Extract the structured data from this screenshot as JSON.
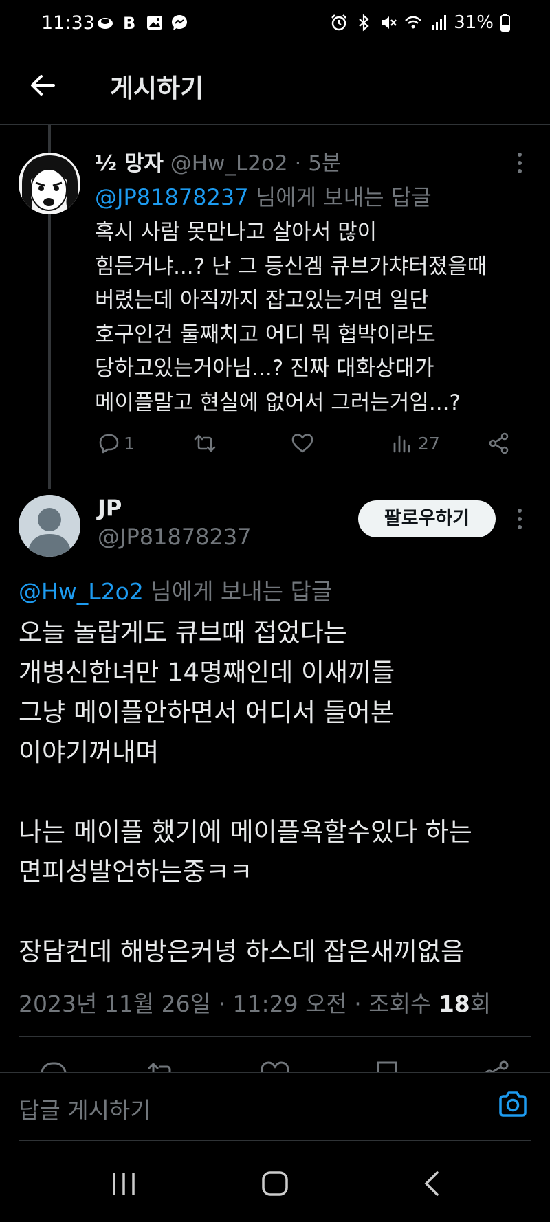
{
  "status_bar": {
    "time": "11:33",
    "left_icons": [
      "threads-icon",
      "b-icon",
      "gallery-icon",
      "messenger-icon"
    ],
    "right_icons": [
      "alarm-icon",
      "bluetooth-icon",
      "mute-icon",
      "wifi-icon",
      "signal-icon"
    ],
    "battery_percent": "31%"
  },
  "header": {
    "title": "게시하기"
  },
  "parent_tweet": {
    "display_name": "½ 망자",
    "handle": "@Hw_L2o2",
    "time": "· 5분",
    "reply_to_mention": "@JP81878237",
    "reply_to_suffix": " 님에게 보내는 답글",
    "text_lines": [
      "혹시 사람 못만나고 살아서 많이",
      "힘든거냐...? 난 그 등신겜 큐브가챠터졌을때",
      "버렸는데 아직까지 잡고있는거면 일단",
      "호구인건 둘째치고 어디 뭐 협박이라도",
      "당하고있는거아님...? 진짜 대화상대가",
      "메이플말고 현실에 없어서 그러는거임...?"
    ],
    "replies": "1",
    "views": "27"
  },
  "main_tweet": {
    "display_name": "JP",
    "handle": "@JP81878237",
    "follow_label": "팔로우하기",
    "reply_to_mention": "@Hw_L2o2",
    "reply_to_suffix": " 님에게 보내는 답글",
    "text": "오늘 놀랍게도 큐브때 접었다는\n개병신한녀만 14명째인데 이새끼들\n그냥 메이플안하면서 어디서 들어본\n이야기꺼내며\n\n나는 메이플 했기에 메이플욕할수있다 하는\n면피성발언하는중ㅋㅋ\n\n장담컨데 해방은커녕 하스데 잡은새끼없음",
    "meta_prefix": "2023년 11월 26일 · 11:29 오전 · 조회수 ",
    "view_count": "18",
    "meta_suffix": "회"
  },
  "composer": {
    "placeholder": "답글 게시하기"
  },
  "colors": {
    "background": "#000000",
    "text": "#e7e9ea",
    "secondary": "#71767b",
    "accent": "#1d9bf0",
    "divider": "#2f3336"
  }
}
